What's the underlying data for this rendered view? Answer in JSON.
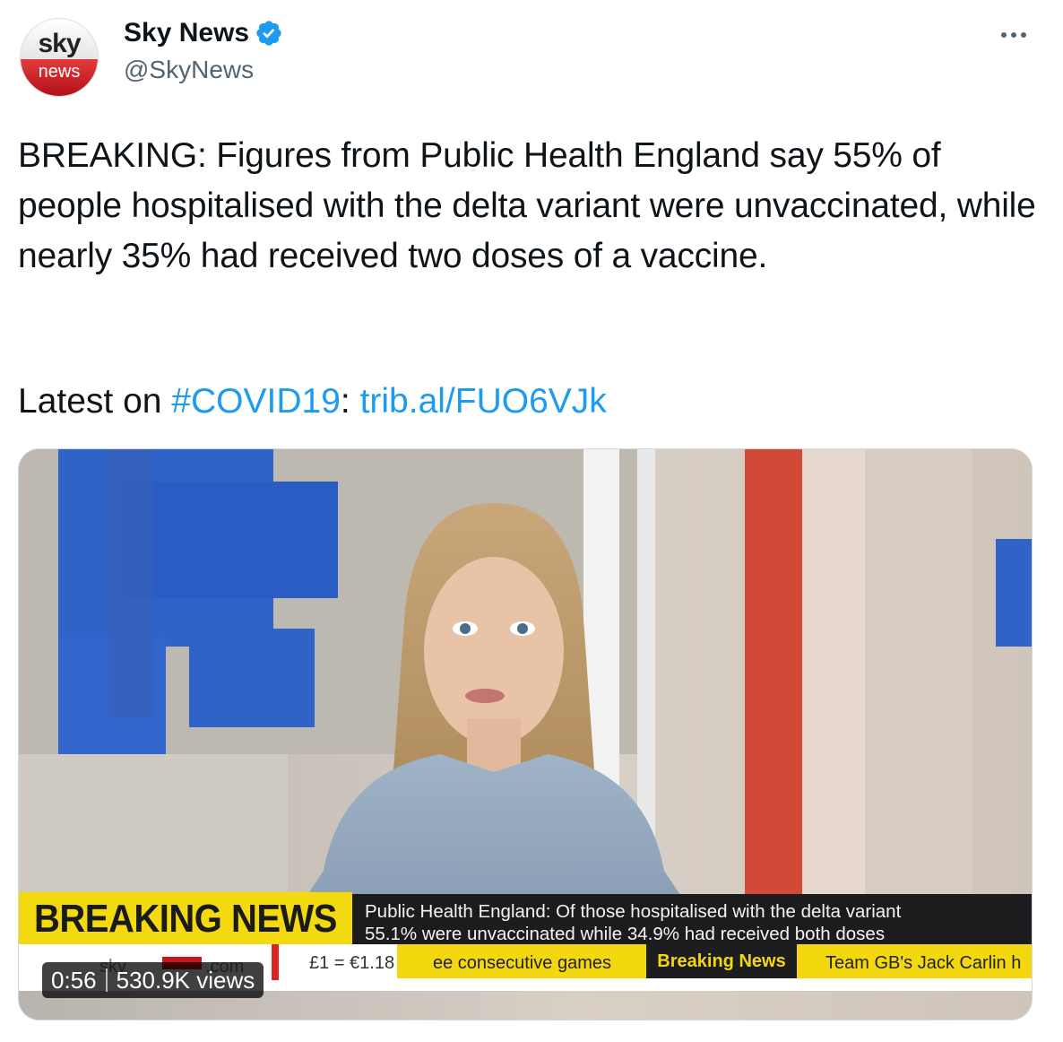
{
  "author": {
    "avatar_top": "sky",
    "avatar_bottom": "news",
    "display_name": "Sky News",
    "handle": "@SkyNews",
    "verified_icon": "verified-badge-icon"
  },
  "tweet": {
    "text": "BREAKING: Figures from Public Health England say 55% of people hospitalised with the delta variant were unvaccinated, while nearly 35% had received two doses of a vaccine.",
    "latest_prefix": "Latest on ",
    "hashtag": "#COVID19",
    "colon": ": ",
    "link": "trib.al/FUO6VJk"
  },
  "media": {
    "breaking_label": "BREAKING NEWS",
    "headline_line1": "Public Health England: Of those hospitalised with the delta variant",
    "headline_line2": "55.1% were unvaccinated while 34.9% had received both doses",
    "ticker_sky": "sky",
    "ticker_com": ".com",
    "ticker_fx": "£1 = €1.18",
    "ticker_games": "ee consecutive games",
    "ticker_breaking": "Breaking News",
    "ticker_team": "Team GB's Jack Carlin h",
    "duration": "0:56",
    "views": "530.9K views"
  },
  "colors": {
    "link": "#1d9bf0",
    "breaking_yellow": "#f3d90f",
    "ticker_dark": "#1c1c1f"
  }
}
